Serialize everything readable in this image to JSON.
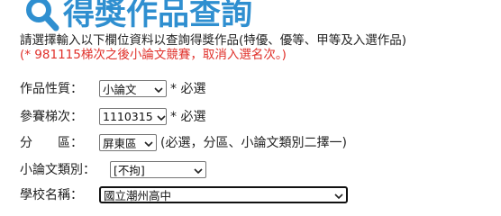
{
  "header": {
    "title": "得獎作品查詢",
    "icon": "search-icon",
    "color": "#2f8fd0"
  },
  "intro": {
    "line1": "請選擇輸入以下欄位資料以查詢得獎作品(特優、優等、甲等及入選作品)",
    "line2": "(* 981115梯次之後小論文競賽，取消入選名次。)",
    "note_color": "#e0302a"
  },
  "form": {
    "type": {
      "label": "作品性質：",
      "value": "小論文",
      "note": "* 必選"
    },
    "round": {
      "label": "參賽梯次：",
      "value": "1110315",
      "note": "* 必選"
    },
    "region": {
      "label": "分　　區：",
      "value": "屏東區",
      "note": "(必選，分區、小論文類別二擇一)"
    },
    "category": {
      "label": "小論文類別：",
      "value": "[不拘]"
    },
    "school": {
      "label": "學校名稱：",
      "value": "國立潮州高中"
    }
  }
}
